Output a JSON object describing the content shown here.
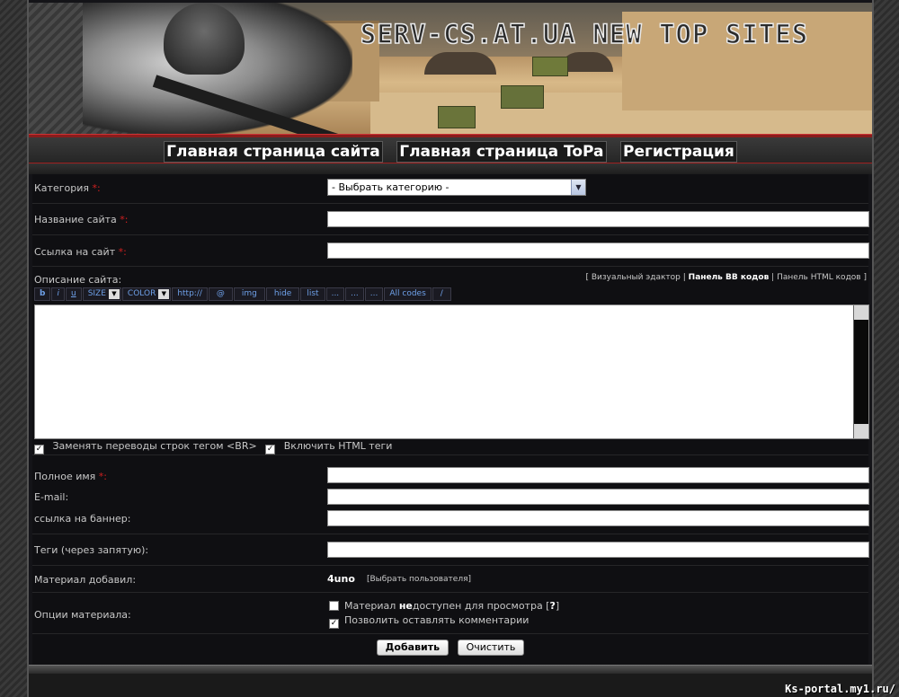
{
  "banner": {
    "title": "SERV-CS.AT.UA NEW TOP SITES"
  },
  "nav": {
    "items": [
      "Главная страница сайта",
      "Главная страница ToPa",
      "Регистрация"
    ]
  },
  "form": {
    "category": {
      "label": "Категория",
      "req": "*:",
      "selected": "- Выбрать категорию -"
    },
    "site_name": {
      "label": "Название сайта",
      "req": "*:",
      "value": ""
    },
    "site_link": {
      "label": "Ссылка на сайт",
      "req": "*:",
      "value": ""
    },
    "description": {
      "label": "Описание сайта:",
      "editor_links": {
        "open": "[",
        "visual": "Визуальный эдактор",
        "sep1": "|",
        "bb": "Панель BB кодов",
        "sep2": "|",
        "html": "Панель HTML кодов",
        "close": "]"
      },
      "toolbar": [
        "b",
        "i",
        "u",
        "SIZE",
        "COLOR",
        "http://",
        "@",
        "img",
        "hide",
        "list",
        "...",
        "...",
        "...",
        "All codes",
        "/"
      ],
      "value": ""
    },
    "options_text": {
      "replace_br": "Заменять переводы строк тегом <BR>",
      "enable_html": "Включить HTML теги"
    },
    "full_name": {
      "label": "Полное имя",
      "req": "*:",
      "value": ""
    },
    "email": {
      "label": "E-mail:",
      "value": ""
    },
    "banner_link": {
      "label": "ссылка на баннер:",
      "value": ""
    },
    "tags": {
      "label": "Теги (через запятую):",
      "value": ""
    },
    "added_by": {
      "label": "Материал добавил:",
      "user": "4uno",
      "pick": "[Выбрать пользователя]"
    },
    "material_options": {
      "label": "Опции материала:",
      "opt1_a": "Материал ",
      "opt1_b": "не",
      "opt1_c": "доступен для просмотра [",
      "opt1_q": "?",
      "opt1_d": "]",
      "opt2": "Позволить оставлять комментарии"
    },
    "buttons": {
      "submit": "Добавить",
      "clear": "Очистить"
    }
  },
  "watermark": "Ks-portal.my1.ru/"
}
